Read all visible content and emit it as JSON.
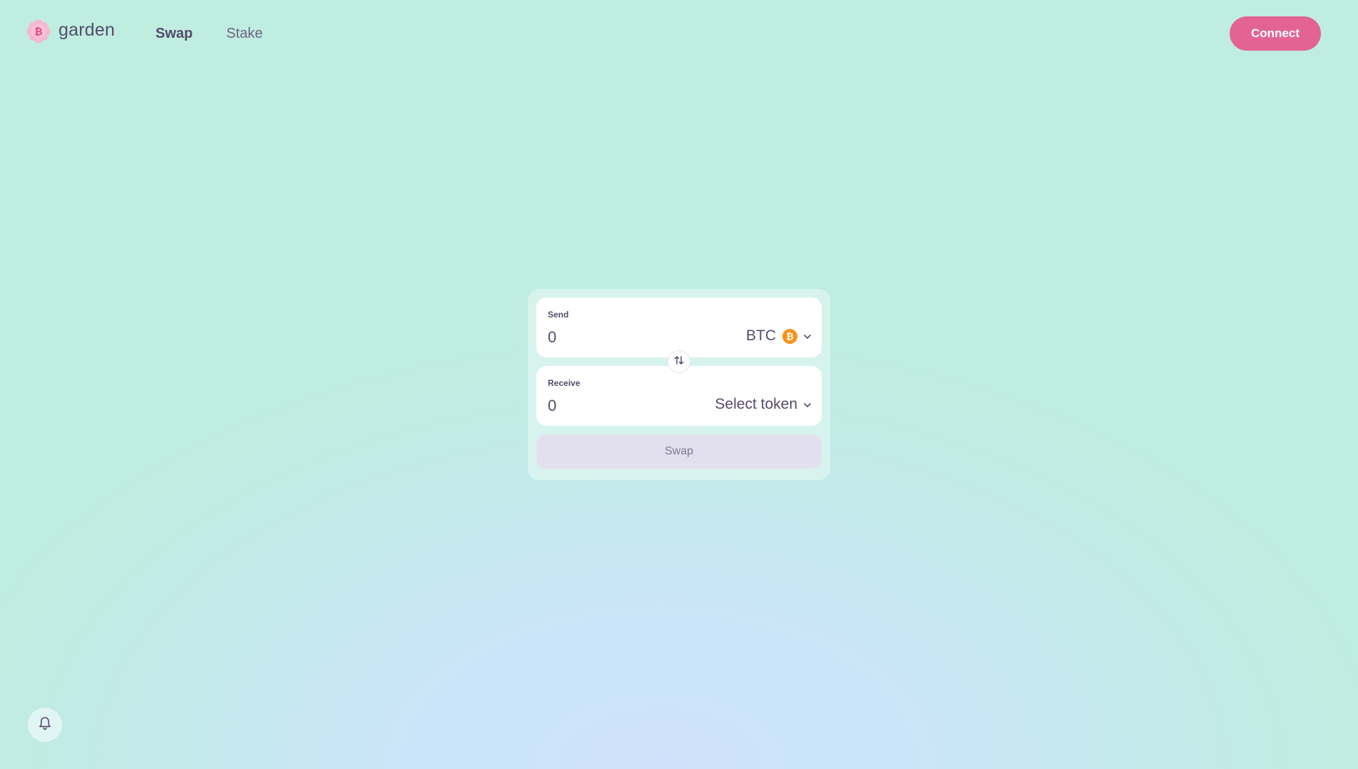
{
  "app": {
    "name": "garden"
  },
  "nav": {
    "items": [
      {
        "label": "Swap",
        "active": true
      },
      {
        "label": "Stake",
        "active": false
      }
    ]
  },
  "header": {
    "connect_label": "Connect"
  },
  "swap": {
    "send": {
      "label": "Send",
      "amount_placeholder": "0",
      "token": "BTC",
      "token_icon": "btc-icon"
    },
    "receive": {
      "label": "Receive",
      "amount_placeholder": "0",
      "token": "Select token"
    },
    "submit_label": "Swap"
  },
  "icons": {
    "logo": "garden-logo-icon",
    "flip": "swap-arrows-icon",
    "notifications": "bell-icon",
    "chevron": "chevron-down-icon"
  },
  "colors": {
    "brand": "#e36492",
    "btc": "#f7931a",
    "text": "#554b6a",
    "background": "#bfede0"
  }
}
